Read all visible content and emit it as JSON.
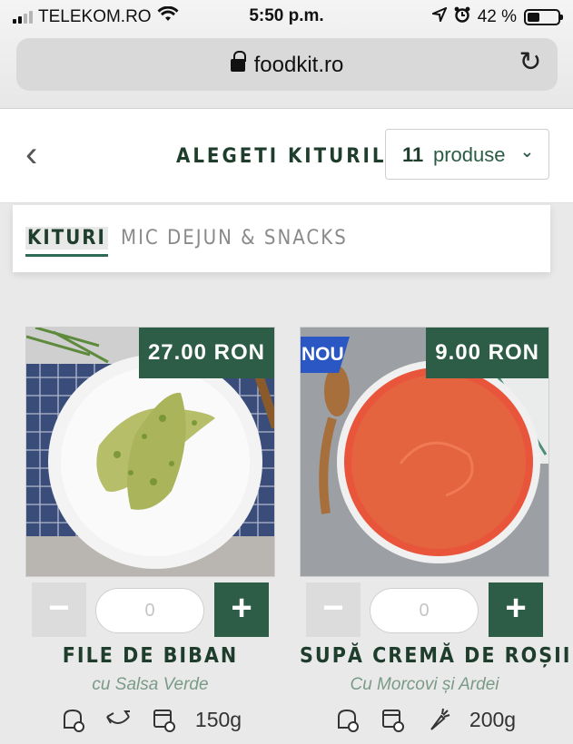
{
  "status": {
    "carrier": "TELEKOM.RO",
    "time": "5:50 p.m.",
    "battery": "42 %",
    "battery_level": 0.42
  },
  "browser": {
    "url": "foodkit.ro"
  },
  "header": {
    "title": "ALEGETI KITURILE",
    "count": "11",
    "count_word": "produse"
  },
  "tabs": [
    {
      "label": "KITURI"
    },
    {
      "label": "MIC DEJUN & SNACKS"
    }
  ],
  "products": [
    {
      "price": "27.00 RON",
      "badge": "",
      "qty": "0",
      "name": "FILE DE BIBAN",
      "subtitle": "cu Salsa Verde",
      "weight": "150g",
      "icons": [
        "bread-icon",
        "fish-icon",
        "oven-icon"
      ]
    },
    {
      "price": "9.00 RON",
      "badge": "NOU",
      "qty": "0",
      "name": "SUPĂ CREMĂ DE ROȘII",
      "subtitle": "Cu Morcovi și Ardei",
      "weight": "200g",
      "icons": [
        "bread-icon",
        "oven-icon",
        "carrot-icon"
      ]
    }
  ],
  "colors": {
    "brand_green": "#2d5c47",
    "dark_green": "#1f3d2c",
    "badge_blue": "#2a57c4"
  }
}
